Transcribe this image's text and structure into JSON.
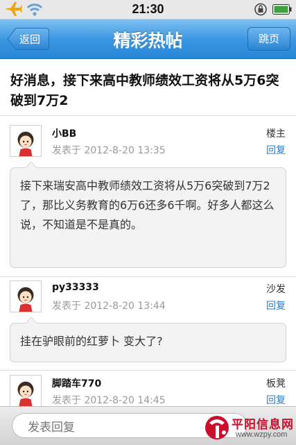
{
  "status_bar": {
    "time": "21:30"
  },
  "nav": {
    "title": "精彩热帖",
    "back_label": "返回",
    "jump_label": "跳页"
  },
  "thread": {
    "title": "好消息，接下来高中教师绩效工资将从5万6突破到7万2"
  },
  "posts": [
    {
      "author": "小BB",
      "meta": "发表于 2012-8-20 13:35",
      "floor": "楼主",
      "reply_label": "回复",
      "content": "接下来瑞安高中教师绩效工资将从5万6突破到7万2了，那比义务教育的6万6还多6千啊。好多人都这么说，不知道是不是真的。"
    },
    {
      "author": "py33333",
      "meta": "发表于 2012-8-20 13:44",
      "floor": "沙发",
      "reply_label": "回复",
      "content": "挂在驴眼前的红萝卜 变大了?"
    },
    {
      "author": "脚踏车770",
      "meta": "发表于 2012-8-20 14:45",
      "floor": "板凳",
      "reply_label": "回复",
      "content": ""
    }
  ],
  "bottom_bar": {
    "input_placeholder": "发表回复"
  },
  "watermark": {
    "name": "平阳信息网",
    "url": "www.wzpy.com"
  },
  "colors": {
    "nav_blue": "#2786d6",
    "link_blue": "#2a7ad0",
    "watermark_red": "#c8102e"
  }
}
